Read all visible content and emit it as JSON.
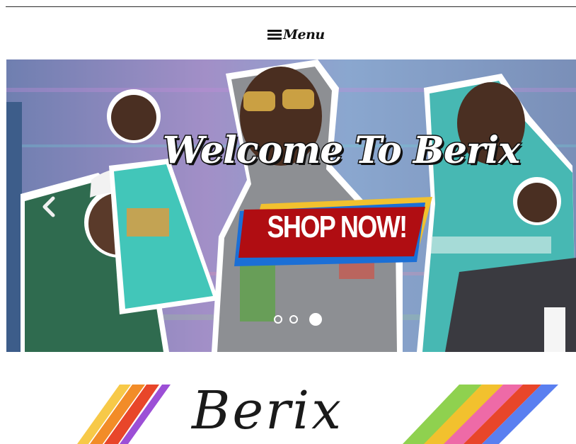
{
  "header": {
    "menu_label": "Menu",
    "menu_icon": "hamburger-icon"
  },
  "hero": {
    "title": "Welcome To Berix",
    "cta_label": "SHOP NOW!",
    "prev_icon": "chevron-left-icon",
    "slides": 3,
    "active_slide": 3
  },
  "brand": {
    "name": "Berix"
  },
  "colors": {
    "cta_red": "#b00d12",
    "cta_blue": "#1b6fd6",
    "cta_yellow": "#f2c12e"
  }
}
